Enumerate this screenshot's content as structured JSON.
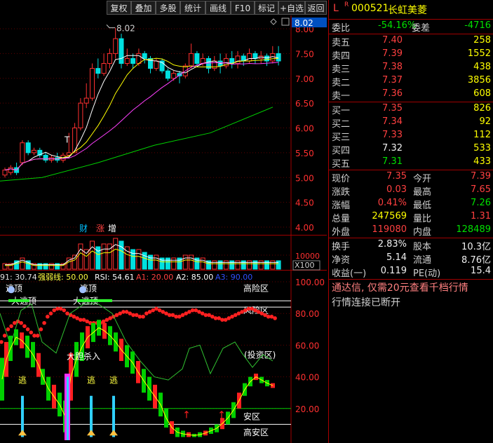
{
  "toolbar": {
    "buttons": [
      "复权",
      "叠加",
      "多股",
      "统计",
      "画线",
      "F10",
      "标记",
      "+自选",
      "返回"
    ]
  },
  "main_chart": {
    "price_ticks": [
      "8.00",
      "7.50",
      "7.00",
      "6.50",
      "6.00",
      "5.50",
      "5.00",
      "4.50",
      "4.00"
    ],
    "high_label": "8.02",
    "current_price_tag": "8.02",
    "t_marker": "T",
    "badges": {
      "cai": "财",
      "zhang": "涨",
      "zeng": "增"
    }
  },
  "volume_chart": {
    "axis_label": "10000",
    "unit_label": "X100"
  },
  "indicator": {
    "header": {
      "prefix": "91: 30.74",
      "strong_weak": "强弱线: 50.00",
      "rsi": "RSI: 54.61",
      "a1": "A1: 20.00",
      "a2": "A2: 85.00",
      "a3": "A3: 90.00"
    },
    "ticks": [
      "100.00",
      "80.00",
      "60.00",
      "40.00",
      "20.00"
    ],
    "zones": {
      "high_risk": "高险区",
      "risk": "风险区",
      "investment": "(投资区)",
      "safe": "安区",
      "high_safe": "高安区"
    },
    "labels": {
      "top": "逃顶",
      "big_top": "大逃顶",
      "bold_buy": "大胆杀入",
      "escape": "逃",
      "arrow": "↑"
    }
  },
  "quote": {
    "prefix_l": "L",
    "prefix_r": "R",
    "code": "000521",
    "name": "长虹美菱",
    "weibi": {
      "label": "委比",
      "value": "-54.16%",
      "label2": "委差",
      "value2": "-4716"
    },
    "asks": [
      {
        "label": "卖五",
        "price": "7.40",
        "vol": "258"
      },
      {
        "label": "卖四",
        "price": "7.39",
        "vol": "1552"
      },
      {
        "label": "卖三",
        "price": "7.38",
        "vol": "438"
      },
      {
        "label": "卖二",
        "price": "7.37",
        "vol": "3856"
      },
      {
        "label": "卖一",
        "price": "7.36",
        "vol": "608"
      }
    ],
    "bids": [
      {
        "label": "买一",
        "price": "7.35",
        "vol": "826"
      },
      {
        "label": "买二",
        "price": "7.34",
        "vol": "92"
      },
      {
        "label": "买三",
        "price": "7.33",
        "vol": "112"
      },
      {
        "label": "买四",
        "price": "7.32",
        "vol": "533"
      },
      {
        "label": "买五",
        "price": "7.31",
        "vol": "433"
      }
    ],
    "stats": [
      {
        "l1": "现价",
        "v1": "7.35",
        "l2": "今开",
        "v2": "7.39"
      },
      {
        "l1": "涨跌",
        "v1": "0.03",
        "l2": "最高",
        "v2": "7.65"
      },
      {
        "l1": "涨幅",
        "v1": "0.41%",
        "l2": "最低",
        "v2": "7.26"
      },
      {
        "l1": "总量",
        "v1": "247569",
        "l2": "量比",
        "v2": "1.31"
      },
      {
        "l1": "外盘",
        "v1": "119080",
        "l2": "内盘",
        "v2": "128489"
      }
    ],
    "stats2": [
      {
        "l1": "换手",
        "v1": "2.83%",
        "l2": "股本",
        "v2": "10.3亿"
      },
      {
        "l1": "净资",
        "v1": "5.14",
        "l2": "流通",
        "v2": "8.76亿"
      },
      {
        "l1": "收益(一)",
        "v1": "0.119",
        "l2": "PE(动)",
        "v2": "15.4"
      }
    ],
    "notice": "通达信, 仅需20元查看千档行情",
    "status": "行情连接已断开"
  }
}
